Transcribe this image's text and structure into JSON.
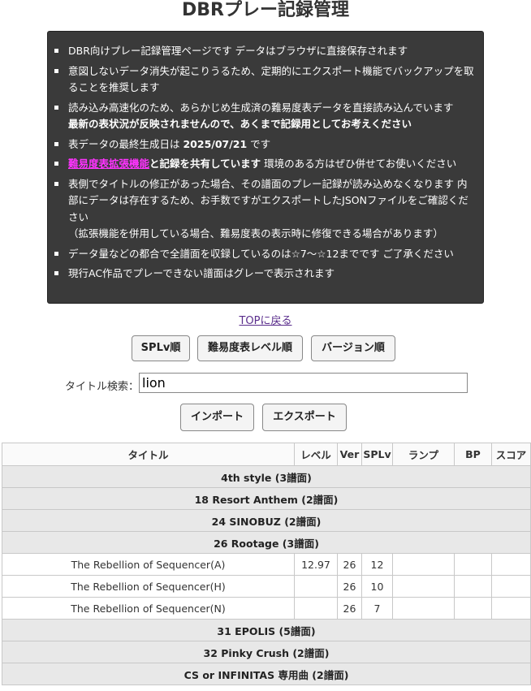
{
  "page": {
    "title": "DBRプレー記録管理"
  },
  "notice": {
    "items": [
      {
        "text": "DBR向けプレー記録管理ページです データはブラウザに直接保存されます"
      },
      {
        "text": "意図しないデータ消失が起こりうるため、定期的にエクスポート機能でバックアップを取ることを推奨します"
      },
      {
        "text": "読み込み高速化のため、あらかじめ生成済の難易度表データを直接読み込んでいます",
        "bold": "最新の表状況が反映されませんので、あくまで記録用としてお考えください"
      },
      {
        "text": "表データの最終生成日は ",
        "bold": "2025/07/21",
        "suffix": " です"
      },
      {
        "link": "難易度表拡張機能",
        "bold": "と記録を共有しています",
        "suffix": " 環境のある方はぜひ併せてお使いください"
      },
      {
        "text": "表側でタイトルの修正があった場合、その譜面のプレー記録が読み込めなくなります 内部にデータは存在するため、お手数ですがエクスポートしたJSONファイルをご確認ください",
        "sub": "（拡張機能を併用している場合、難易度表の表示時に修復できる場合があります）"
      },
      {
        "text": "データ量などの都合で全譜面を収録しているのは☆7〜☆12までです ご了承ください"
      },
      {
        "text": "現行AC作品でプレーできない譜面はグレーで表示されます"
      }
    ]
  },
  "nav": {
    "top_link": "TOPに戻る"
  },
  "sort_buttons": {
    "splv": "SPLv順",
    "difficulty": "難易度表レベル順",
    "version": "バージョン順"
  },
  "search": {
    "label": "タイトル検索：",
    "value": "lion"
  },
  "io_buttons": {
    "import": "インポート",
    "export": "エクスポート"
  },
  "table": {
    "headers": {
      "title": "タイトル",
      "level": "レベル",
      "ver": "Ver",
      "splv": "SPLv",
      "lamp": "ランプ",
      "bp": "BP",
      "score": "スコア"
    },
    "groups": [
      {
        "label": "4th style (3譜面)"
      },
      {
        "label": "18 Resort Anthem (2譜面)"
      },
      {
        "label": "24 SINOBUZ (2譜面)"
      },
      {
        "label": "26 Rootage (3譜面)"
      },
      {
        "label": "31 EPOLIS (5譜面)"
      },
      {
        "label": "32 Pinky Crush (2譜面)"
      },
      {
        "label": "CS or INFINITAS 専用曲 (2譜面)"
      }
    ],
    "songs": [
      {
        "title": "The Rebellion of Sequencer(A)",
        "level": "12.97",
        "ver": "26",
        "splv": "12",
        "lamp": "",
        "bp": "",
        "score": ""
      },
      {
        "title": "The Rebellion of Sequencer(H)",
        "level": "",
        "ver": "26",
        "splv": "10",
        "lamp": "",
        "bp": "",
        "score": ""
      },
      {
        "title": "The Rebellion of Sequencer(N)",
        "level": "",
        "ver": "26",
        "splv": "7",
        "lamp": "",
        "bp": "",
        "score": ""
      }
    ]
  }
}
